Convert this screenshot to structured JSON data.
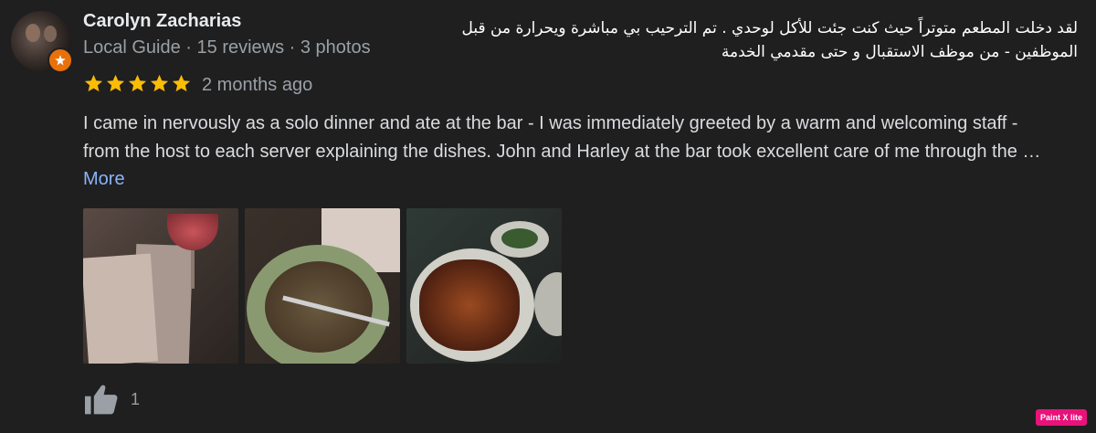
{
  "reviewer": {
    "name": "Carolyn Zacharias",
    "meta": "Local Guide · 15 reviews · 3 photos"
  },
  "rating": {
    "stars": 5,
    "max": 5,
    "time": "2 months ago"
  },
  "arabic_text": "لقد دخلت المطعم متوتراً حيث كنت جئت للأكل لوحدي . تم الترحيب بي مباشرة ويحرارة من قبل الموظفين - من موظف الاستقبال و حتى مقدمي الخدمة",
  "review": {
    "text": "I came in nervously as a solo dinner and ate at the bar - I was immediately greeted by a warm and welcoming staff - from the host to each server explaining the dishes. John and Harley at the bar took excellent care of me through the … ",
    "more_label": "More"
  },
  "likes": {
    "count": "1"
  },
  "colors": {
    "star": "#fbbc04",
    "link": "#8ab4f8",
    "badge": "#e8710a"
  },
  "watermark": "Paint X lite"
}
